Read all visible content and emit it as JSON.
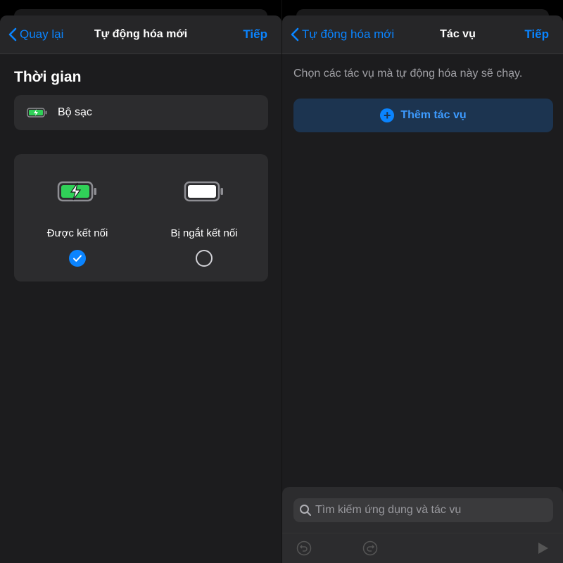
{
  "left": {
    "nav": {
      "back_label": "Quay lại",
      "title": "Tự động hóa mới",
      "next_label": "Tiếp"
    },
    "section_title": "Thời gian",
    "trigger_label": "Bộ sạc",
    "options": [
      {
        "label": "Được kết nối",
        "selected": true
      },
      {
        "label": "Bị ngắt kết nối",
        "selected": false
      }
    ]
  },
  "right": {
    "nav": {
      "back_label": "Tự động hóa mới",
      "title": "Tác vụ",
      "next_label": "Tiếp"
    },
    "description": "Chọn các tác vụ mà tự động hóa này sẽ chạy.",
    "add_action_label": "Thêm tác vụ",
    "search": {
      "placeholder": "Tìm kiếm ứng dụng và tác vụ"
    }
  },
  "colors": {
    "accent": "#0a84ff",
    "charging": "#30d158"
  }
}
